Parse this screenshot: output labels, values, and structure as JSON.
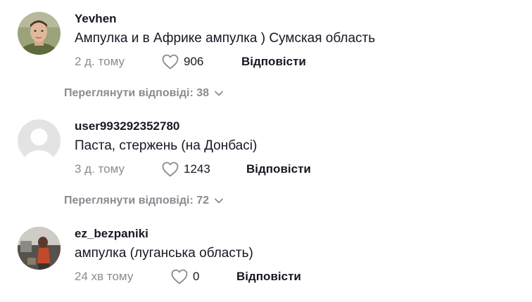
{
  "comments": [
    {
      "username": "Yevhen",
      "text": "Ампулка и в Африке ампулка ) Сумская область",
      "time": "2 д. тому",
      "likes": "906",
      "reply_label": "Відповісти",
      "avatar_icon": "user-photo-avatar"
    },
    {
      "username": "user993292352780",
      "text": "Паста, стержень (на Донбасі)",
      "time": "3 д. тому",
      "likes": "1243",
      "reply_label": "Відповісти",
      "avatar_icon": "default-avatar"
    },
    {
      "username": "ez_bezpaniki",
      "text": "ампулка (луганська область)",
      "time": "24 хв тому",
      "likes": "0",
      "reply_label": "Відповісти",
      "avatar_icon": "user-photo-avatar"
    }
  ],
  "view_replies": [
    {
      "label": "Переглянути відповіді: 38",
      "icon": "chevron-down-icon"
    },
    {
      "label": "Переглянути відповіді: 72",
      "icon": "chevron-down-icon"
    }
  ],
  "colors": {
    "primary_text": "#161823",
    "secondary_text": "#8a8b91",
    "default_avatar_bg": "#e3e3e3"
  }
}
